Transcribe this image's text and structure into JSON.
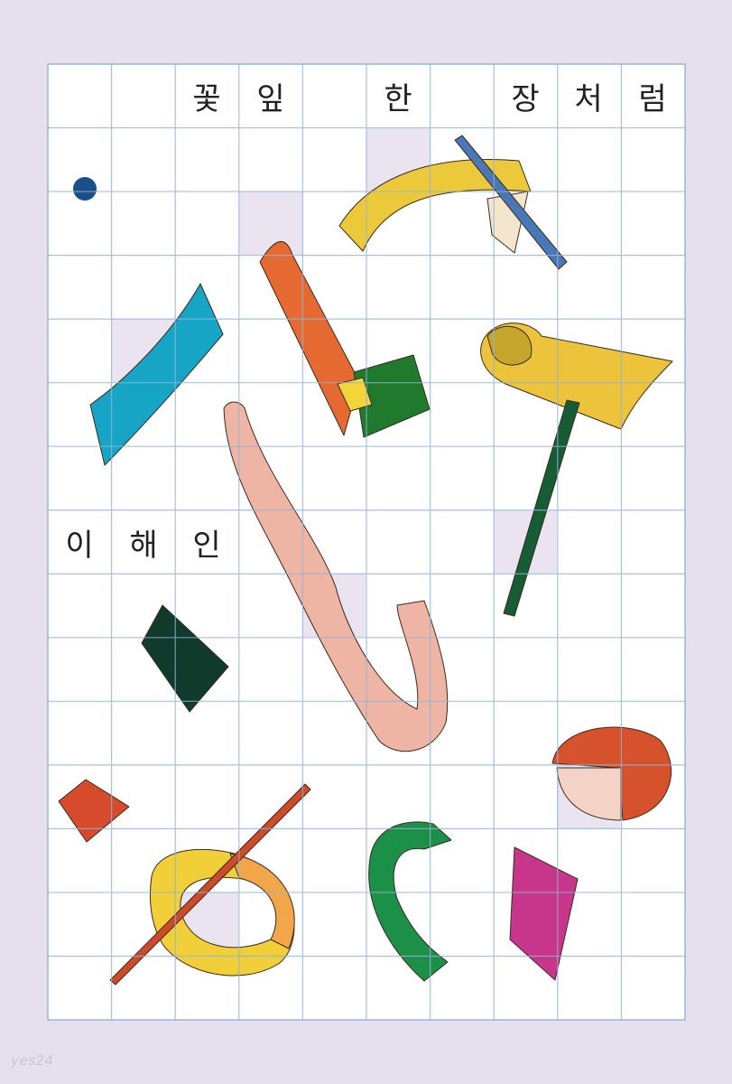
{
  "cover": {
    "title_chars": [
      "꽃",
      "잎",
      "한",
      "장",
      "처",
      "럼"
    ],
    "author_chars": [
      "이",
      "해",
      "인"
    ],
    "watermark": "yes24"
  },
  "colors": {
    "background": "#e6e0ee",
    "grid_line": "#8fb3d6",
    "sheet": "#ffffff"
  }
}
